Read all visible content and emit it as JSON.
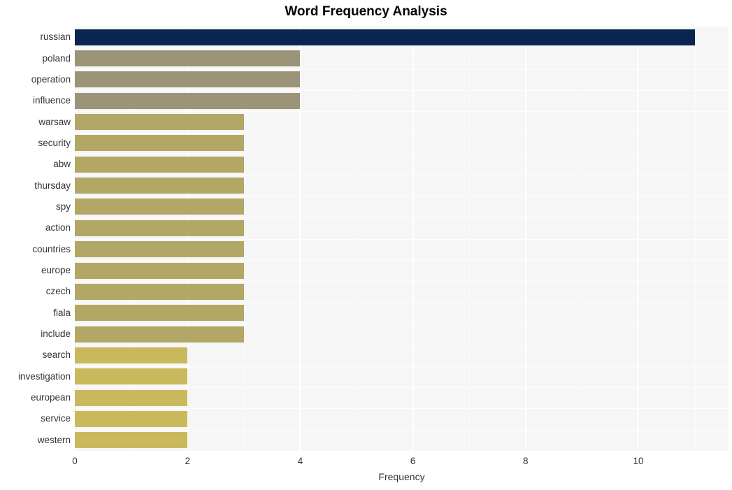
{
  "chart_data": {
    "type": "bar",
    "orientation": "horizontal",
    "title": "Word Frequency Analysis",
    "xlabel": "Frequency",
    "ylabel": "",
    "xlim": [
      0,
      11.6
    ],
    "ylim": [
      0,
      20
    ],
    "grid": true,
    "legend": null,
    "xticks": [
      0,
      2,
      4,
      6,
      8,
      10
    ],
    "xtick_labels": [
      "0",
      "2",
      "4",
      "6",
      "8",
      "10"
    ],
    "categories": [
      "russian",
      "poland",
      "operation",
      "influence",
      "warsaw",
      "security",
      "abw",
      "thursday",
      "spy",
      "action",
      "countries",
      "europe",
      "czech",
      "fiala",
      "include",
      "search",
      "investigation",
      "european",
      "service",
      "western"
    ],
    "values": [
      11,
      4,
      4,
      4,
      3,
      3,
      3,
      3,
      3,
      3,
      3,
      3,
      3,
      3,
      3,
      2,
      2,
      2,
      2,
      2
    ],
    "bar_colors": [
      "#0a2550",
      "#9c9478",
      "#9c9478",
      "#9c9478",
      "#b3a766",
      "#b3a766",
      "#b3a766",
      "#b3a766",
      "#b3a766",
      "#b3a766",
      "#b3a766",
      "#b3a766",
      "#b3a766",
      "#b3a766",
      "#b3a766",
      "#c9b95c",
      "#c9b95c",
      "#c9b95c",
      "#c9b95c",
      "#c9b95c"
    ],
    "plot_background": "#f6f6f7",
    "gridline_color": "#ffffff",
    "text_color": "#333333",
    "title_color": "#000000"
  }
}
